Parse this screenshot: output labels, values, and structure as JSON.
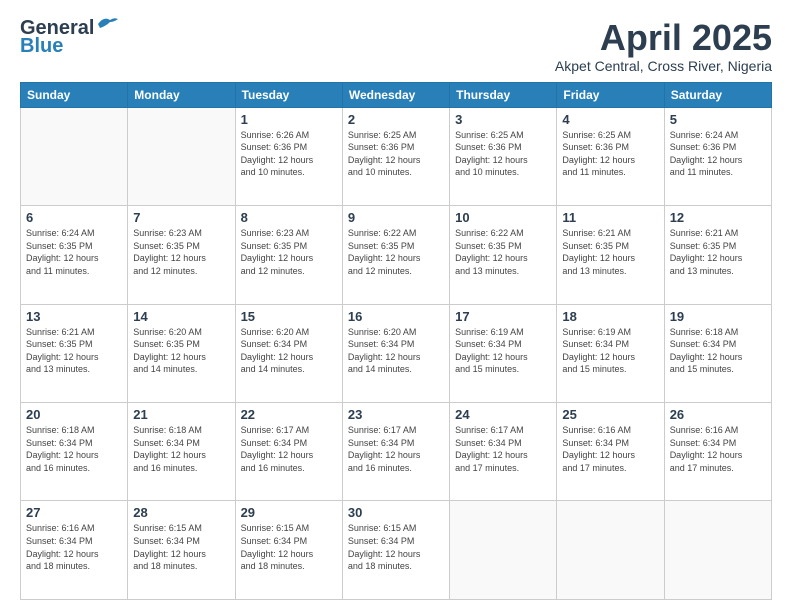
{
  "header": {
    "logo_line1": "General",
    "logo_line2": "Blue",
    "month": "April 2025",
    "location": "Akpet Central, Cross River, Nigeria"
  },
  "weekdays": [
    "Sunday",
    "Monday",
    "Tuesday",
    "Wednesday",
    "Thursday",
    "Friday",
    "Saturday"
  ],
  "weeks": [
    [
      {
        "day": "",
        "info": ""
      },
      {
        "day": "",
        "info": ""
      },
      {
        "day": "1",
        "info": "Sunrise: 6:26 AM\nSunset: 6:36 PM\nDaylight: 12 hours\nand 10 minutes."
      },
      {
        "day": "2",
        "info": "Sunrise: 6:25 AM\nSunset: 6:36 PM\nDaylight: 12 hours\nand 10 minutes."
      },
      {
        "day": "3",
        "info": "Sunrise: 6:25 AM\nSunset: 6:36 PM\nDaylight: 12 hours\nand 10 minutes."
      },
      {
        "day": "4",
        "info": "Sunrise: 6:25 AM\nSunset: 6:36 PM\nDaylight: 12 hours\nand 11 minutes."
      },
      {
        "day": "5",
        "info": "Sunrise: 6:24 AM\nSunset: 6:36 PM\nDaylight: 12 hours\nand 11 minutes."
      }
    ],
    [
      {
        "day": "6",
        "info": "Sunrise: 6:24 AM\nSunset: 6:35 PM\nDaylight: 12 hours\nand 11 minutes."
      },
      {
        "day": "7",
        "info": "Sunrise: 6:23 AM\nSunset: 6:35 PM\nDaylight: 12 hours\nand 12 minutes."
      },
      {
        "day": "8",
        "info": "Sunrise: 6:23 AM\nSunset: 6:35 PM\nDaylight: 12 hours\nand 12 minutes."
      },
      {
        "day": "9",
        "info": "Sunrise: 6:22 AM\nSunset: 6:35 PM\nDaylight: 12 hours\nand 12 minutes."
      },
      {
        "day": "10",
        "info": "Sunrise: 6:22 AM\nSunset: 6:35 PM\nDaylight: 12 hours\nand 13 minutes."
      },
      {
        "day": "11",
        "info": "Sunrise: 6:21 AM\nSunset: 6:35 PM\nDaylight: 12 hours\nand 13 minutes."
      },
      {
        "day": "12",
        "info": "Sunrise: 6:21 AM\nSunset: 6:35 PM\nDaylight: 12 hours\nand 13 minutes."
      }
    ],
    [
      {
        "day": "13",
        "info": "Sunrise: 6:21 AM\nSunset: 6:35 PM\nDaylight: 12 hours\nand 13 minutes."
      },
      {
        "day": "14",
        "info": "Sunrise: 6:20 AM\nSunset: 6:35 PM\nDaylight: 12 hours\nand 14 minutes."
      },
      {
        "day": "15",
        "info": "Sunrise: 6:20 AM\nSunset: 6:34 PM\nDaylight: 12 hours\nand 14 minutes."
      },
      {
        "day": "16",
        "info": "Sunrise: 6:20 AM\nSunset: 6:34 PM\nDaylight: 12 hours\nand 14 minutes."
      },
      {
        "day": "17",
        "info": "Sunrise: 6:19 AM\nSunset: 6:34 PM\nDaylight: 12 hours\nand 15 minutes."
      },
      {
        "day": "18",
        "info": "Sunrise: 6:19 AM\nSunset: 6:34 PM\nDaylight: 12 hours\nand 15 minutes."
      },
      {
        "day": "19",
        "info": "Sunrise: 6:18 AM\nSunset: 6:34 PM\nDaylight: 12 hours\nand 15 minutes."
      }
    ],
    [
      {
        "day": "20",
        "info": "Sunrise: 6:18 AM\nSunset: 6:34 PM\nDaylight: 12 hours\nand 16 minutes."
      },
      {
        "day": "21",
        "info": "Sunrise: 6:18 AM\nSunset: 6:34 PM\nDaylight: 12 hours\nand 16 minutes."
      },
      {
        "day": "22",
        "info": "Sunrise: 6:17 AM\nSunset: 6:34 PM\nDaylight: 12 hours\nand 16 minutes."
      },
      {
        "day": "23",
        "info": "Sunrise: 6:17 AM\nSunset: 6:34 PM\nDaylight: 12 hours\nand 16 minutes."
      },
      {
        "day": "24",
        "info": "Sunrise: 6:17 AM\nSunset: 6:34 PM\nDaylight: 12 hours\nand 17 minutes."
      },
      {
        "day": "25",
        "info": "Sunrise: 6:16 AM\nSunset: 6:34 PM\nDaylight: 12 hours\nand 17 minutes."
      },
      {
        "day": "26",
        "info": "Sunrise: 6:16 AM\nSunset: 6:34 PM\nDaylight: 12 hours\nand 17 minutes."
      }
    ],
    [
      {
        "day": "27",
        "info": "Sunrise: 6:16 AM\nSunset: 6:34 PM\nDaylight: 12 hours\nand 18 minutes."
      },
      {
        "day": "28",
        "info": "Sunrise: 6:15 AM\nSunset: 6:34 PM\nDaylight: 12 hours\nand 18 minutes."
      },
      {
        "day": "29",
        "info": "Sunrise: 6:15 AM\nSunset: 6:34 PM\nDaylight: 12 hours\nand 18 minutes."
      },
      {
        "day": "30",
        "info": "Sunrise: 6:15 AM\nSunset: 6:34 PM\nDaylight: 12 hours\nand 18 minutes."
      },
      {
        "day": "",
        "info": ""
      },
      {
        "day": "",
        "info": ""
      },
      {
        "day": "",
        "info": ""
      }
    ]
  ]
}
